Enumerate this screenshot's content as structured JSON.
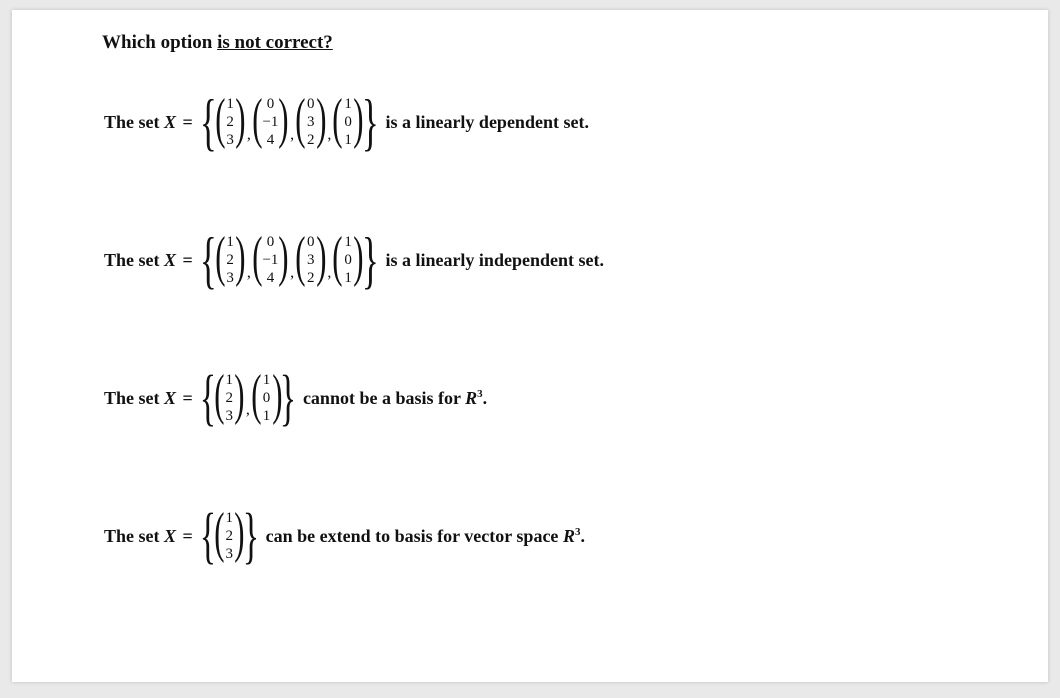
{
  "question": {
    "lead": "Which option ",
    "underlined": "is not correct?"
  },
  "options": [
    {
      "prefix": "The set ",
      "var": "X",
      "eq": " = ",
      "vectors": [
        {
          "entries": [
            "1",
            "2",
            "3"
          ]
        },
        {
          "entries": [
            "0",
            "−1",
            "4"
          ]
        },
        {
          "entries": [
            "0",
            "3",
            "2"
          ]
        },
        {
          "entries": [
            "1",
            "0",
            "1"
          ]
        }
      ],
      "suffix": " is a linearly dependent set."
    },
    {
      "prefix": "The set ",
      "var": "X",
      "eq": " = ",
      "vectors": [
        {
          "entries": [
            "1",
            "2",
            "3"
          ]
        },
        {
          "entries": [
            "0",
            "−1",
            "4"
          ]
        },
        {
          "entries": [
            "0",
            "3",
            "2"
          ]
        },
        {
          "entries": [
            "1",
            "0",
            "1"
          ]
        }
      ],
      "suffix": " is a linearly independent set."
    },
    {
      "prefix": "The set ",
      "var": "X",
      "eq": " = ",
      "vectors": [
        {
          "entries": [
            "1",
            "2",
            "3"
          ]
        },
        {
          "entries": [
            "1",
            "0",
            "1"
          ]
        }
      ],
      "suffix_parts": {
        "a": " cannot be a basis for ",
        "R": "R",
        "sup": "3",
        "dot": "."
      }
    },
    {
      "prefix": "The set ",
      "var": "X",
      "eq": " = ",
      "vectors": [
        {
          "entries": [
            "1",
            "2",
            "3"
          ]
        }
      ],
      "suffix_parts": {
        "a": " can be extend to basis for vector space ",
        "R": "R",
        "sup": "3",
        "dot": "."
      }
    }
  ]
}
